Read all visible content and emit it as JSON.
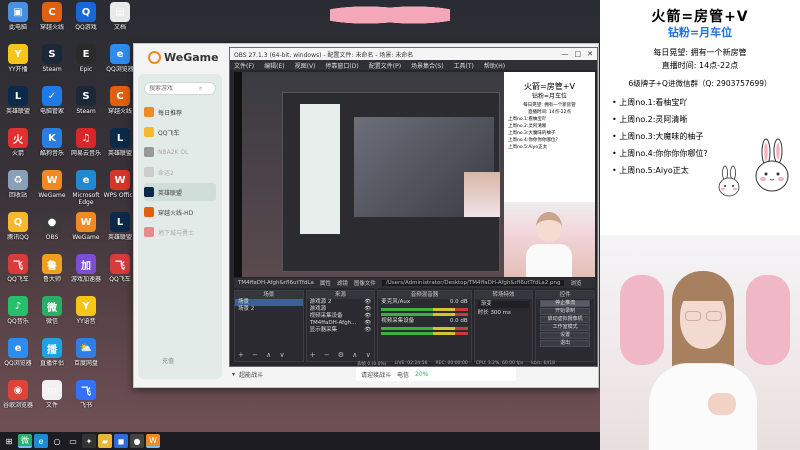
{
  "desktop": {
    "icons": [
      {
        "label": "此电脑",
        "color": "#4a90e2",
        "glyph": "▣"
      },
      {
        "label": "YY开播",
        "color": "#f5c518",
        "glyph": "Y"
      },
      {
        "label": "英雄联盟",
        "color": "#0b2a4a",
        "glyph": "L"
      },
      {
        "label": "火箭",
        "color": "#e03030",
        "glyph": "火"
      },
      {
        "label": "回收站",
        "color": "#8aa0b8",
        "glyph": "♻"
      },
      {
        "label": "腾讯QQ",
        "color": "#f5b82e",
        "glyph": "Q"
      },
      {
        "label": "QQ飞车",
        "color": "#d93a3a",
        "glyph": "飞"
      },
      {
        "label": "QQ音乐",
        "color": "#25c06b",
        "glyph": "♪"
      },
      {
        "label": "QQ浏览器",
        "color": "#2d8cf0",
        "glyph": "e"
      },
      {
        "label": "谷歌浏览器",
        "color": "#db4437",
        "glyph": "◉"
      },
      {
        "label": "穿越火线",
        "color": "#e06010",
        "glyph": "C"
      },
      {
        "label": "Steam",
        "color": "#1b2838",
        "glyph": "S"
      },
      {
        "label": "电脑管家",
        "color": "#1e7ae6",
        "glyph": "✓"
      },
      {
        "label": "酷狗音乐",
        "color": "#2a7de1",
        "glyph": "K"
      },
      {
        "label": "WeGame",
        "color": "#f08a24",
        "glyph": "W"
      },
      {
        "label": "OBS",
        "color": "#3a3a3a",
        "glyph": "●"
      },
      {
        "label": "鲁大师",
        "color": "#f0a020",
        "glyph": "鲁"
      },
      {
        "label": "微信",
        "color": "#2aae67",
        "glyph": "微"
      },
      {
        "label": "直播伴侣",
        "color": "#1fa3e0",
        "glyph": "播"
      },
      {
        "label": "文件",
        "color": "#f2f2f2",
        "glyph": "▭"
      },
      {
        "label": "QQ游戏",
        "color": "#1667d9",
        "glyph": "Q"
      },
      {
        "label": "Epic",
        "color": "#2a2a2a",
        "glyph": "E"
      },
      {
        "label": "Steam",
        "color": "#1b2838",
        "glyph": "S"
      },
      {
        "label": "网易云音乐",
        "color": "#d9262b",
        "glyph": "♫"
      },
      {
        "label": "Microsoft Edge",
        "color": "#1f8ad2",
        "glyph": "e"
      },
      {
        "label": "WeGame",
        "color": "#f08a24",
        "glyph": "W"
      },
      {
        "label": "游戏加速器",
        "color": "#7b4fd1",
        "glyph": "加"
      },
      {
        "label": "YY语音",
        "color": "#f5c518",
        "glyph": "Y"
      },
      {
        "label": "百度网盘",
        "color": "#2f7ee8",
        "glyph": "⛅"
      },
      {
        "label": "飞书",
        "color": "#3370ff",
        "glyph": "飞"
      },
      {
        "label": "文档",
        "color": "#e9e9e9",
        "glyph": "▤"
      },
      {
        "label": "QQ浏览器",
        "color": "#2d8cf0",
        "glyph": "e"
      },
      {
        "label": "穿越火线",
        "color": "#e06010",
        "glyph": "C"
      },
      {
        "label": "英雄联盟",
        "color": "#0b2a4a",
        "glyph": "L"
      },
      {
        "label": "WPS Office",
        "color": "#d8352a",
        "glyph": "W"
      },
      {
        "label": "英雄联盟",
        "color": "#0b2a4a",
        "glyph": "L"
      },
      {
        "label": "QQ飞车",
        "color": "#d93a3a",
        "glyph": "飞"
      }
    ]
  },
  "taskbar": {
    "icons": [
      {
        "name": "start-icon",
        "glyph": "⊞",
        "color": "#1c1c22"
      },
      {
        "name": "wechat-icon",
        "glyph": "微",
        "color": "#2aae67"
      },
      {
        "name": "edge-icon",
        "glyph": "e",
        "color": "#1f8ad2"
      },
      {
        "name": "search-icon",
        "glyph": "○",
        "color": "#1c1c22"
      },
      {
        "name": "taskview-icon",
        "glyph": "▭",
        "color": "#1c1c22"
      },
      {
        "name": "game-icon",
        "glyph": "✦",
        "color": "#333"
      },
      {
        "name": "folder-icon",
        "glyph": "▰",
        "color": "#e8b53a"
      },
      {
        "name": "app-icon",
        "glyph": "◼",
        "color": "#2d6cd6"
      },
      {
        "name": "obs-icon",
        "glyph": "●",
        "color": "#444"
      },
      {
        "name": "wegame-icon",
        "glyph": "W",
        "color": "#f08a24"
      }
    ]
  },
  "wegame": {
    "brand": "WeGame",
    "search_placeholder": "搜索游戏",
    "nav": [
      {
        "label": "每日推荐",
        "color": "#f08a24",
        "selected": false,
        "dim": false
      },
      {
        "label": "QQ飞车",
        "color": "#f5b82e",
        "selected": false,
        "dim": false
      },
      {
        "label": "NBA2K OL",
        "color": "#999999",
        "selected": false,
        "dim": true
      },
      {
        "label": "命运2",
        "color": "#cccccc",
        "selected": false,
        "dim": true
      },
      {
        "label": "英雄联盟",
        "color": "#0b2a4a",
        "selected": true,
        "dim": false
      },
      {
        "label": "穿越火线-HD",
        "color": "#e06010",
        "selected": false,
        "dim": false
      },
      {
        "label": "地下城与勇士",
        "color": "#e88a8a",
        "selected": false,
        "dim": true
      }
    ],
    "recharge": "充值",
    "bottom_region": "超能战斗",
    "continue_label": "请迎接战斗",
    "continue_sub": "电信",
    "continue_badge": "20%"
  },
  "obs": {
    "title": "OBS 27.1.3 (64-bit, windows) - 配置文件: 未命名 - 场景: 未命名",
    "window_controls": [
      "—",
      "□",
      "✕"
    ],
    "menu": [
      "文件(F)",
      "编辑(E)",
      "视图(V)",
      "停靠窗口(D)",
      "配置文件(P)",
      "场景集合(S)",
      "工具(T)",
      "帮助(H)"
    ],
    "source_bar": {
      "name": "TM4ffaDH-Afgh&rfl6utTfdLa",
      "props_label": "属性",
      "filters_label": "滤镜",
      "image_file_label": "图像文件",
      "path": "/Users/Administrator/Desktop/TM4ffaDH-Afgh&rfl6utTfdLa2.png",
      "browse_label": "浏览"
    },
    "scenes": {
      "header": "场景",
      "items": [
        "场景",
        "场景 2"
      ]
    },
    "sources": {
      "header": "来源",
      "items": [
        "游戏源 2",
        "游戏源",
        "视频采集设备",
        "TM4ffaDH-Afgh...",
        "显示器采集"
      ]
    },
    "mixer": {
      "header": "音频混音器",
      "tracks": [
        {
          "name": "麦克风/Aux",
          "level": "0.0 dB"
        },
        {
          "name": "视频采集设备",
          "level": "0.0 dB"
        }
      ]
    },
    "transitions": {
      "header": "转场特效",
      "mode": "渐变",
      "duration_label": "时长",
      "duration": "300 ms"
    },
    "controls": {
      "header": "控件",
      "buttons": [
        "停止推流",
        "开始录制",
        "启动虚拟摄像机",
        "工作室模式",
        "设置",
        "退出"
      ]
    },
    "status": [
      "丢帧 0 (0.0%)",
      "LIVE: 02:24:56",
      "REC: 00:00:00",
      "CPU: 3.2%, 60.00 fps",
      "kb/s: 6418"
    ]
  },
  "overlay": {
    "title": "火箭=房管+V",
    "subtitle": "钻粉=月车位",
    "hope": "每日晃望: 拥有一个新房管",
    "hours": "直播时间: 14点-22点",
    "qq": "6级牌子+Q进微信群（Q: 2903757699）",
    "ranks": [
      {
        "label": "上周no.1:",
        "name": "看柚宝吖"
      },
      {
        "label": "上周no.2:",
        "name": "灵阿清晰"
      },
      {
        "label": "上周no.3:",
        "name": "大魔味的柚子"
      },
      {
        "label": "上周no.4:",
        "name": "你你你你哪位?"
      },
      {
        "label": "上周no.5:",
        "name": "Aiyo正太"
      }
    ],
    "icons": [
      "bunny-big-icon",
      "bunny-small-icon"
    ]
  }
}
